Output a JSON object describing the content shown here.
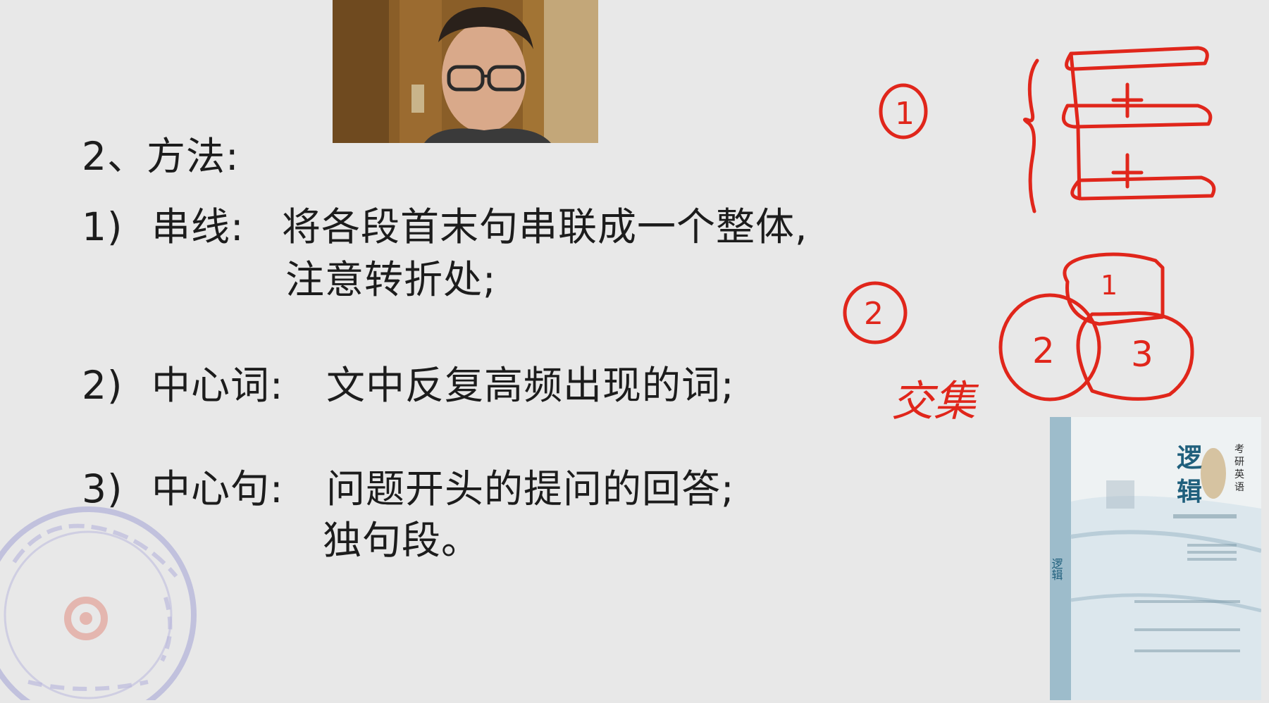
{
  "slide": {
    "title": "2、方法:",
    "items": [
      {
        "number": "1)",
        "term": "串线:",
        "lines": [
          "将各段首末句串联成一个整体,",
          "注意转折处;"
        ]
      },
      {
        "number": "2)",
        "term": "中心词:",
        "lines": [
          "文中反复高频出现的词;"
        ]
      },
      {
        "number": "3)",
        "term": "中心句:",
        "lines": [
          "问题开头的提问的回答;",
          "独句段。"
        ]
      }
    ]
  },
  "annotations": {
    "circle_labels": [
      "1",
      "2",
      "1",
      "2",
      "3"
    ],
    "handwriting": "交集",
    "color": "#e0261b"
  },
  "book": {
    "title_chars": [
      "逻",
      "辑"
    ],
    "subtitle_chars": [
      "考",
      "研",
      "英",
      "语"
    ],
    "spine_title": "逻辑",
    "accent": "#8fb3c4"
  },
  "webcam": {
    "icon": "webcam-video-feed"
  }
}
